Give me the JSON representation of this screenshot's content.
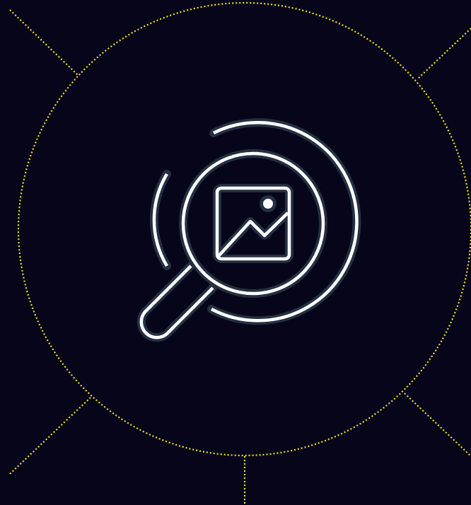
{
  "colors": {
    "background": "#07051a",
    "dotted_guides": "#f2e21b",
    "icon_stroke": "#ffffff",
    "icon_outline": "#243041"
  },
  "icon": {
    "name": "image-search-icon",
    "parts": [
      "magnifier-lens-icon",
      "magnifier-handle-icon",
      "picture-frame-icon",
      "mountain-icon",
      "sun-dot-icon",
      "orbit-arc-icon"
    ]
  },
  "guides": {
    "style": "dotted",
    "shape": "circle-with-radial-lines"
  }
}
